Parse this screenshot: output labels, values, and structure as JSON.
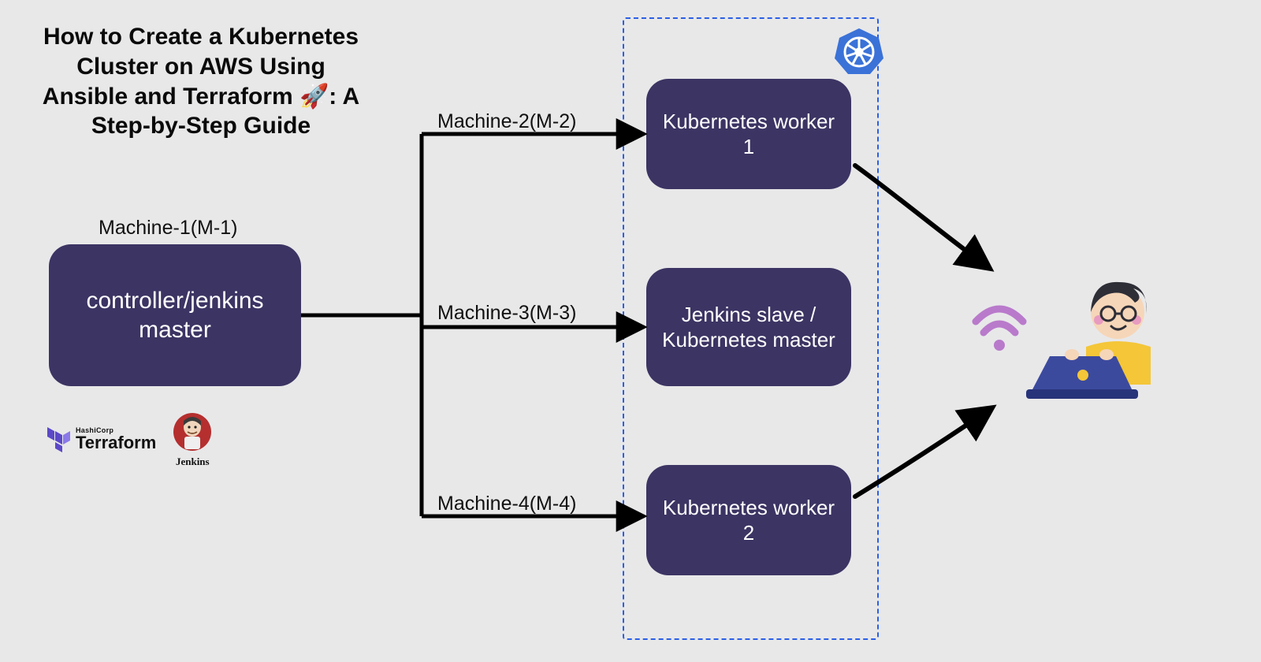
{
  "title": "How to Create a Kubernetes Cluster on AWS Using Ansible and Terraform 🚀: A Step-by-Step Guide",
  "labels": {
    "m1": "Machine-1(M-1)",
    "m2": "Machine-2(M-2)",
    "m3": "Machine-3(M-3)",
    "m4": "Machine-4(M-4)"
  },
  "nodes": {
    "controller": "controller/jenkins master",
    "worker1": "Kubernetes worker 1",
    "jenkins_slave": "Jenkins slave  / Kubernetes master",
    "worker2": "Kubernetes worker 2"
  },
  "logos": {
    "terraform_vendor": "HashiCorp",
    "terraform": "Terraform",
    "jenkins": "Jenkins"
  }
}
